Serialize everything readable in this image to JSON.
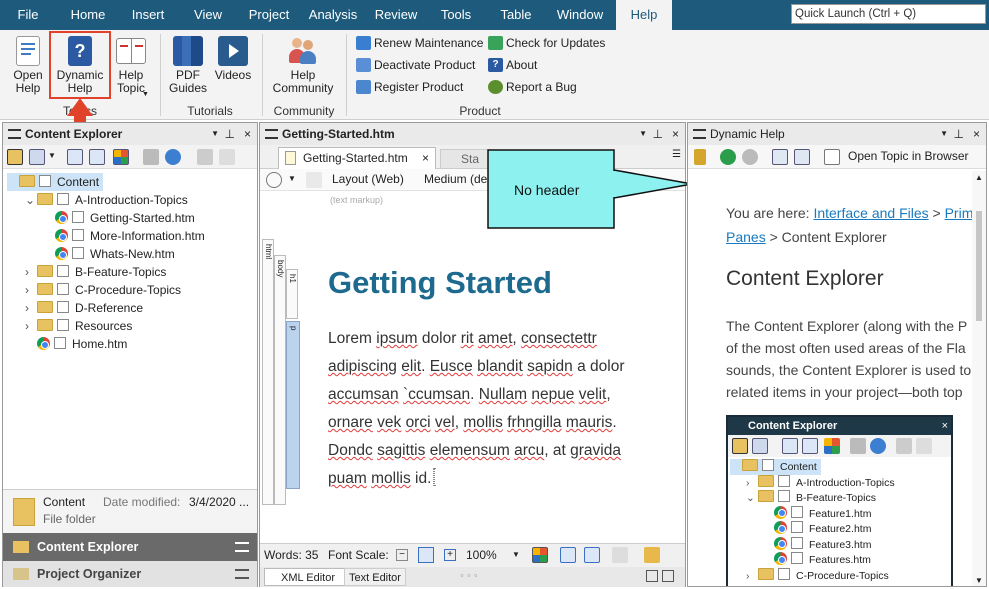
{
  "menu": {
    "tabs": [
      "File",
      "Home",
      "Insert",
      "View",
      "Project",
      "Analysis",
      "Review",
      "Tools",
      "Table",
      "Window",
      "Help"
    ],
    "active": "Help",
    "quick_launch": "Quick Launch (Ctrl + Q)"
  },
  "ribbon": {
    "open_help": "Open\nHelp",
    "dynamic_help": "Dynamic\nHelp",
    "help_topic": "Help\nTopic",
    "pdf_guides": "PDF\nGuides",
    "videos": "Videos",
    "help_community": "Help\nCommunity",
    "renew_maintenance": "Renew Maintenance",
    "deactivate_product": "Deactivate Product",
    "register_product": "Register Product",
    "check_updates": "Check for Updates",
    "about": "About",
    "report_bug": "Report a Bug",
    "groups": {
      "topics": "Topics",
      "tutorials": "Tutorials",
      "community": "Community",
      "product": "Product"
    }
  },
  "content_explorer": {
    "title": "Content Explorer",
    "tree": [
      {
        "label": "Content",
        "type": "folder",
        "level": 0,
        "expand": ""
      },
      {
        "label": "A-Introduction-Topics",
        "type": "folder",
        "level": 1,
        "expand": "v"
      },
      {
        "label": "Getting-Started.htm",
        "type": "file",
        "level": 2,
        "expand": ""
      },
      {
        "label": "More-Information.htm",
        "type": "file",
        "level": 2,
        "expand": ""
      },
      {
        "label": "Whats-New.htm",
        "type": "file",
        "level": 2,
        "expand": ""
      },
      {
        "label": "B-Feature-Topics",
        "type": "folder",
        "level": 1,
        "expand": ">"
      },
      {
        "label": "C-Procedure-Topics",
        "type": "folder",
        "level": 1,
        "expand": ">"
      },
      {
        "label": "D-Reference",
        "type": "folder",
        "level": 1,
        "expand": ">"
      },
      {
        "label": "Resources",
        "type": "folder",
        "level": 1,
        "expand": ">"
      },
      {
        "label": "Home.htm",
        "type": "file",
        "level": 1,
        "expand": ""
      }
    ],
    "details": {
      "name": "Content",
      "modified_label": "Date modified:",
      "modified_value": "3/4/2020 ...",
      "type": "File folder"
    },
    "bottom_tabs": [
      "Content Explorer",
      "Project Organizer"
    ]
  },
  "editor": {
    "title": "Getting-Started.htm",
    "tab_active": "Getting-Started.htm",
    "tab_other": "Sta",
    "layout": "Layout (Web)",
    "medium": "Medium (de",
    "text_markup": "(text markup)",
    "gutter": [
      "html",
      "body",
      "h1",
      "p"
    ],
    "heading": "Getting Started",
    "para_segments": [
      {
        "t": "Lorem ",
        "s": false
      },
      {
        "t": "ipsum",
        "s": true
      },
      {
        "t": " dolor ",
        "s": false
      },
      {
        "t": "rit",
        "s": true
      },
      {
        "t": " ",
        "s": false
      },
      {
        "t": "amet",
        "s": true
      },
      {
        "t": ", ",
        "s": false
      },
      {
        "t": "consectettr",
        "s": true
      },
      {
        "t": " ",
        "s": false
      },
      {
        "t": "adipiscing",
        "s": true
      },
      {
        "t": " ",
        "s": false
      },
      {
        "t": "elit",
        "s": true
      },
      {
        "t": ".  ",
        "s": false
      },
      {
        "t": "Eusce",
        "s": true
      },
      {
        "t": " ",
        "s": false
      },
      {
        "t": "blandit",
        "s": true
      },
      {
        "t": " ",
        "s": false
      },
      {
        "t": "sapidn",
        "s": true
      },
      {
        "t": " a dolor ",
        "s": false
      },
      {
        "t": "accumsan",
        "s": true
      },
      {
        "t": " ",
        "s": false
      },
      {
        "t": "`ccumsan",
        "s": true
      },
      {
        "t": ".  ",
        "s": false
      },
      {
        "t": "Nullam",
        "s": true
      },
      {
        "t": " ",
        "s": false
      },
      {
        "t": "nepue",
        "s": true
      },
      {
        "t": " ",
        "s": false
      },
      {
        "t": "velit",
        "s": true
      },
      {
        "t": ", ",
        "s": false
      },
      {
        "t": "ornare",
        "s": true
      },
      {
        "t": " ",
        "s": false
      },
      {
        "t": "vek",
        "s": true
      },
      {
        "t": " ",
        "s": false
      },
      {
        "t": "orci",
        "s": true
      },
      {
        "t": " ",
        "s": false
      },
      {
        "t": "vel",
        "s": true
      },
      {
        "t": ", ",
        "s": false
      },
      {
        "t": "mollis",
        "s": true
      },
      {
        "t": " ",
        "s": false
      },
      {
        "t": "frhngilla",
        "s": true
      },
      {
        "t": " ",
        "s": false
      },
      {
        "t": "mauris",
        "s": true
      },
      {
        "t": ".  ",
        "s": false
      },
      {
        "t": "Dondc",
        "s": true
      },
      {
        "t": " ",
        "s": false
      },
      {
        "t": "sagittis",
        "s": true
      },
      {
        "t": " ",
        "s": false
      },
      {
        "t": "elemensum",
        "s": true
      },
      {
        "t": " ",
        "s": false
      },
      {
        "t": "arcu",
        "s": true
      },
      {
        "t": ", at ",
        "s": false
      },
      {
        "t": "gravida",
        "s": true
      },
      {
        "t": " ",
        "s": false
      },
      {
        "t": "puam",
        "s": true
      },
      {
        "t": " ",
        "s": false
      },
      {
        "t": "mollis",
        "s": true
      },
      {
        "t": " id.",
        "s": false
      }
    ],
    "status": {
      "words": "Words: 35",
      "font_scale": "Font Scale:",
      "zoom": "100%"
    },
    "bottom_tabs": [
      "XML Editor",
      "Text Editor"
    ]
  },
  "callout": "No header",
  "dynamic_help": {
    "title": "Dynamic Help",
    "open_topic": "Open Topic in Browser",
    "breadcrumb_prefix": "You are here: ",
    "bc1": "Interface and Files",
    "bc_sep": " > ",
    "bc2": "Prim",
    "bc3": "Panes",
    "bc_tail": " > Content Explorer",
    "heading": "Content Explorer",
    "body": [
      "The Content Explorer (along with the P",
      "of the most often used areas of the Fla",
      "sounds, the Content Explorer is used to",
      "related items in your project—both top"
    ],
    "mini": {
      "title": "Content Explorer",
      "tree": [
        {
          "label": "Content",
          "type": "folder",
          "expand": "",
          "level": 0
        },
        {
          "label": "A-Introduction-Topics",
          "type": "folder",
          "expand": ">",
          "level": 1
        },
        {
          "label": "B-Feature-Topics",
          "type": "folder",
          "expand": "v",
          "level": 1
        },
        {
          "label": "Feature1.htm",
          "type": "file",
          "expand": "",
          "level": 2
        },
        {
          "label": "Feature2.htm",
          "type": "file",
          "expand": "",
          "level": 2
        },
        {
          "label": "Feature3.htm",
          "type": "file",
          "expand": "",
          "level": 2
        },
        {
          "label": "Features.htm",
          "type": "file",
          "expand": "",
          "level": 2
        },
        {
          "label": "C-Procedure-Topics",
          "type": "folder",
          "expand": ">",
          "level": 1
        }
      ]
    }
  }
}
